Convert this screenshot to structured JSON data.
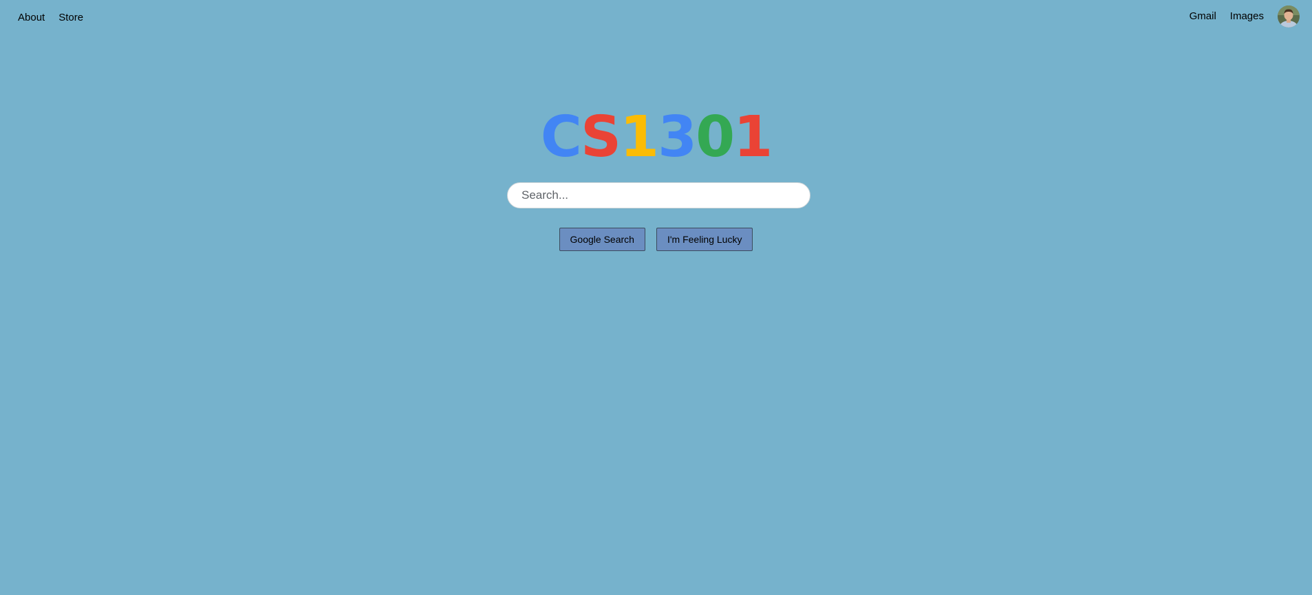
{
  "colors": {
    "background": "#76b2cc",
    "button_bg": "#6b8ec1",
    "logo_blue": "#4285f4",
    "logo_red": "#ea4335",
    "logo_yellow": "#fbbc05",
    "logo_green": "#34a853"
  },
  "nav": {
    "left": [
      "About",
      "Store"
    ],
    "right": [
      "Gmail",
      "Images"
    ],
    "avatar_icon": "user-avatar-photo"
  },
  "logo": {
    "letters": [
      {
        "char": "C",
        "color": "#4285f4"
      },
      {
        "char": "S",
        "color": "#ea4335"
      },
      {
        "char": "1",
        "color": "#fbbc05"
      },
      {
        "char": "3",
        "color": "#4285f4"
      },
      {
        "char": "0",
        "color": "#34a853"
      },
      {
        "char": "1",
        "color": "#ea4335"
      }
    ]
  },
  "search": {
    "placeholder": "Search...",
    "value": ""
  },
  "buttons": {
    "search": "Google Search",
    "lucky": "I'm Feeling Lucky"
  }
}
